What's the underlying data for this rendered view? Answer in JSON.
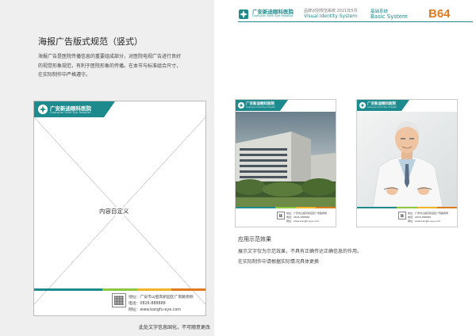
{
  "header": {
    "hospital_cn": "广安新迪眼科医院",
    "hospital_en": "Guang'an Xindi Eye Hospital",
    "vi_cn": "品牌识别规范系统 2021年5月",
    "vi_en": "Visual Identity System",
    "system_cn": "基础系统",
    "system_en": "Basic System",
    "page_code": "B64",
    "accent_color": "#1f8a8a",
    "code_color": "#e07a1e"
  },
  "section": {
    "title": "海报广告版式规范（竖式）",
    "description": "海报广告是医院传播信息的重要组成部分，对医院电视广告进行良好的视觉形象规范，有利于医院形象的传播。在本节与标准组合尺寸，在实际制作中严格遵守。"
  },
  "template_poster": {
    "header_title": "广安新迪眼科医院",
    "header_en": "Guang'an Xindi Eye Hospital",
    "content_label": "内容自定义",
    "address": "地址：广安市山壁高新园区广南路南侧",
    "phone": "电话：0826-888888",
    "website": "网址：www.kangfu-eye.com",
    "bar_colors": [
      "#1d8a8d",
      "#8dc63f",
      "#f0b429",
      "#e07a1e"
    ]
  },
  "example_posters": [
    {
      "image": "hospital-building-photo",
      "header_title": "广安新迪眼科医院",
      "header_en": "Guang'an Xindi Eye Hospital",
      "address": "地址：广安市山壁高新园区广南路南侧",
      "phone": "电话：0826-888888",
      "website": "网址：www.kangfu-eye.com"
    },
    {
      "image": "doctor-portrait-photo",
      "header_title": "广安新迪眼科医院",
      "header_en": "Guang'an Xindi Eye Hospital",
      "address": "地址：广安市山壁高新园区广南路南侧",
      "phone": "电话：0826-888888",
      "website": "网址：www.kangfu-eye.com"
    }
  ],
  "example": {
    "title": "应用示范效果",
    "lines": [
      "展示文字仅为示范效果，不具有正确传达正确信息的作用。",
      "在实际制作中请根据实际情况具体更换"
    ]
  },
  "footnote": "此处文字信息固化，不可随意更改"
}
